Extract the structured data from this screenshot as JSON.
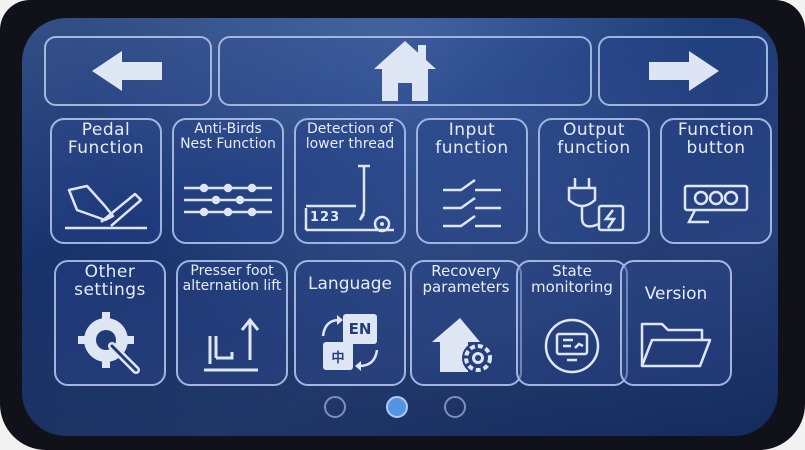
{
  "nav": {
    "back_icon": "left-arrow-icon",
    "home_icon": "home-icon",
    "forward_icon": "right-arrow-icon"
  },
  "tiles": [
    {
      "label": "Pedal\nFunction",
      "icon": "foot-pedal-icon"
    },
    {
      "label": "Anti-Birds\nNest Function",
      "icon": "thread-lines-icon"
    },
    {
      "label": "Detection of\nlower thread",
      "icon": "needle-counter-icon",
      "icon_text": "123"
    },
    {
      "label": "Input\nfunction",
      "icon": "input-switch-icon"
    },
    {
      "label": "Output\nfunction",
      "icon": "plug-power-icon"
    },
    {
      "label": "Function\nbutton",
      "icon": "button-panel-icon"
    },
    {
      "label": "Other\nsettings",
      "icon": "gear-wrench-icon"
    },
    {
      "label": "Presser foot\nalternation lift",
      "icon": "presser-foot-lift-icon"
    },
    {
      "label": "Language",
      "icon": "language-icon",
      "icon_text_en": "EN",
      "icon_text_zh": "中"
    },
    {
      "label": "Recovery\nparameters",
      "icon": "home-gear-icon"
    },
    {
      "label": "State\nmonitoring",
      "icon": "monitor-chart-icon"
    },
    {
      "label": "Version",
      "icon": "folder-icon"
    }
  ],
  "pagination": {
    "pages": 3,
    "current": 2
  },
  "colors": {
    "outline": "#9fb2dc",
    "background": "#1a3570",
    "active_dot": "#4f8fe0"
  }
}
